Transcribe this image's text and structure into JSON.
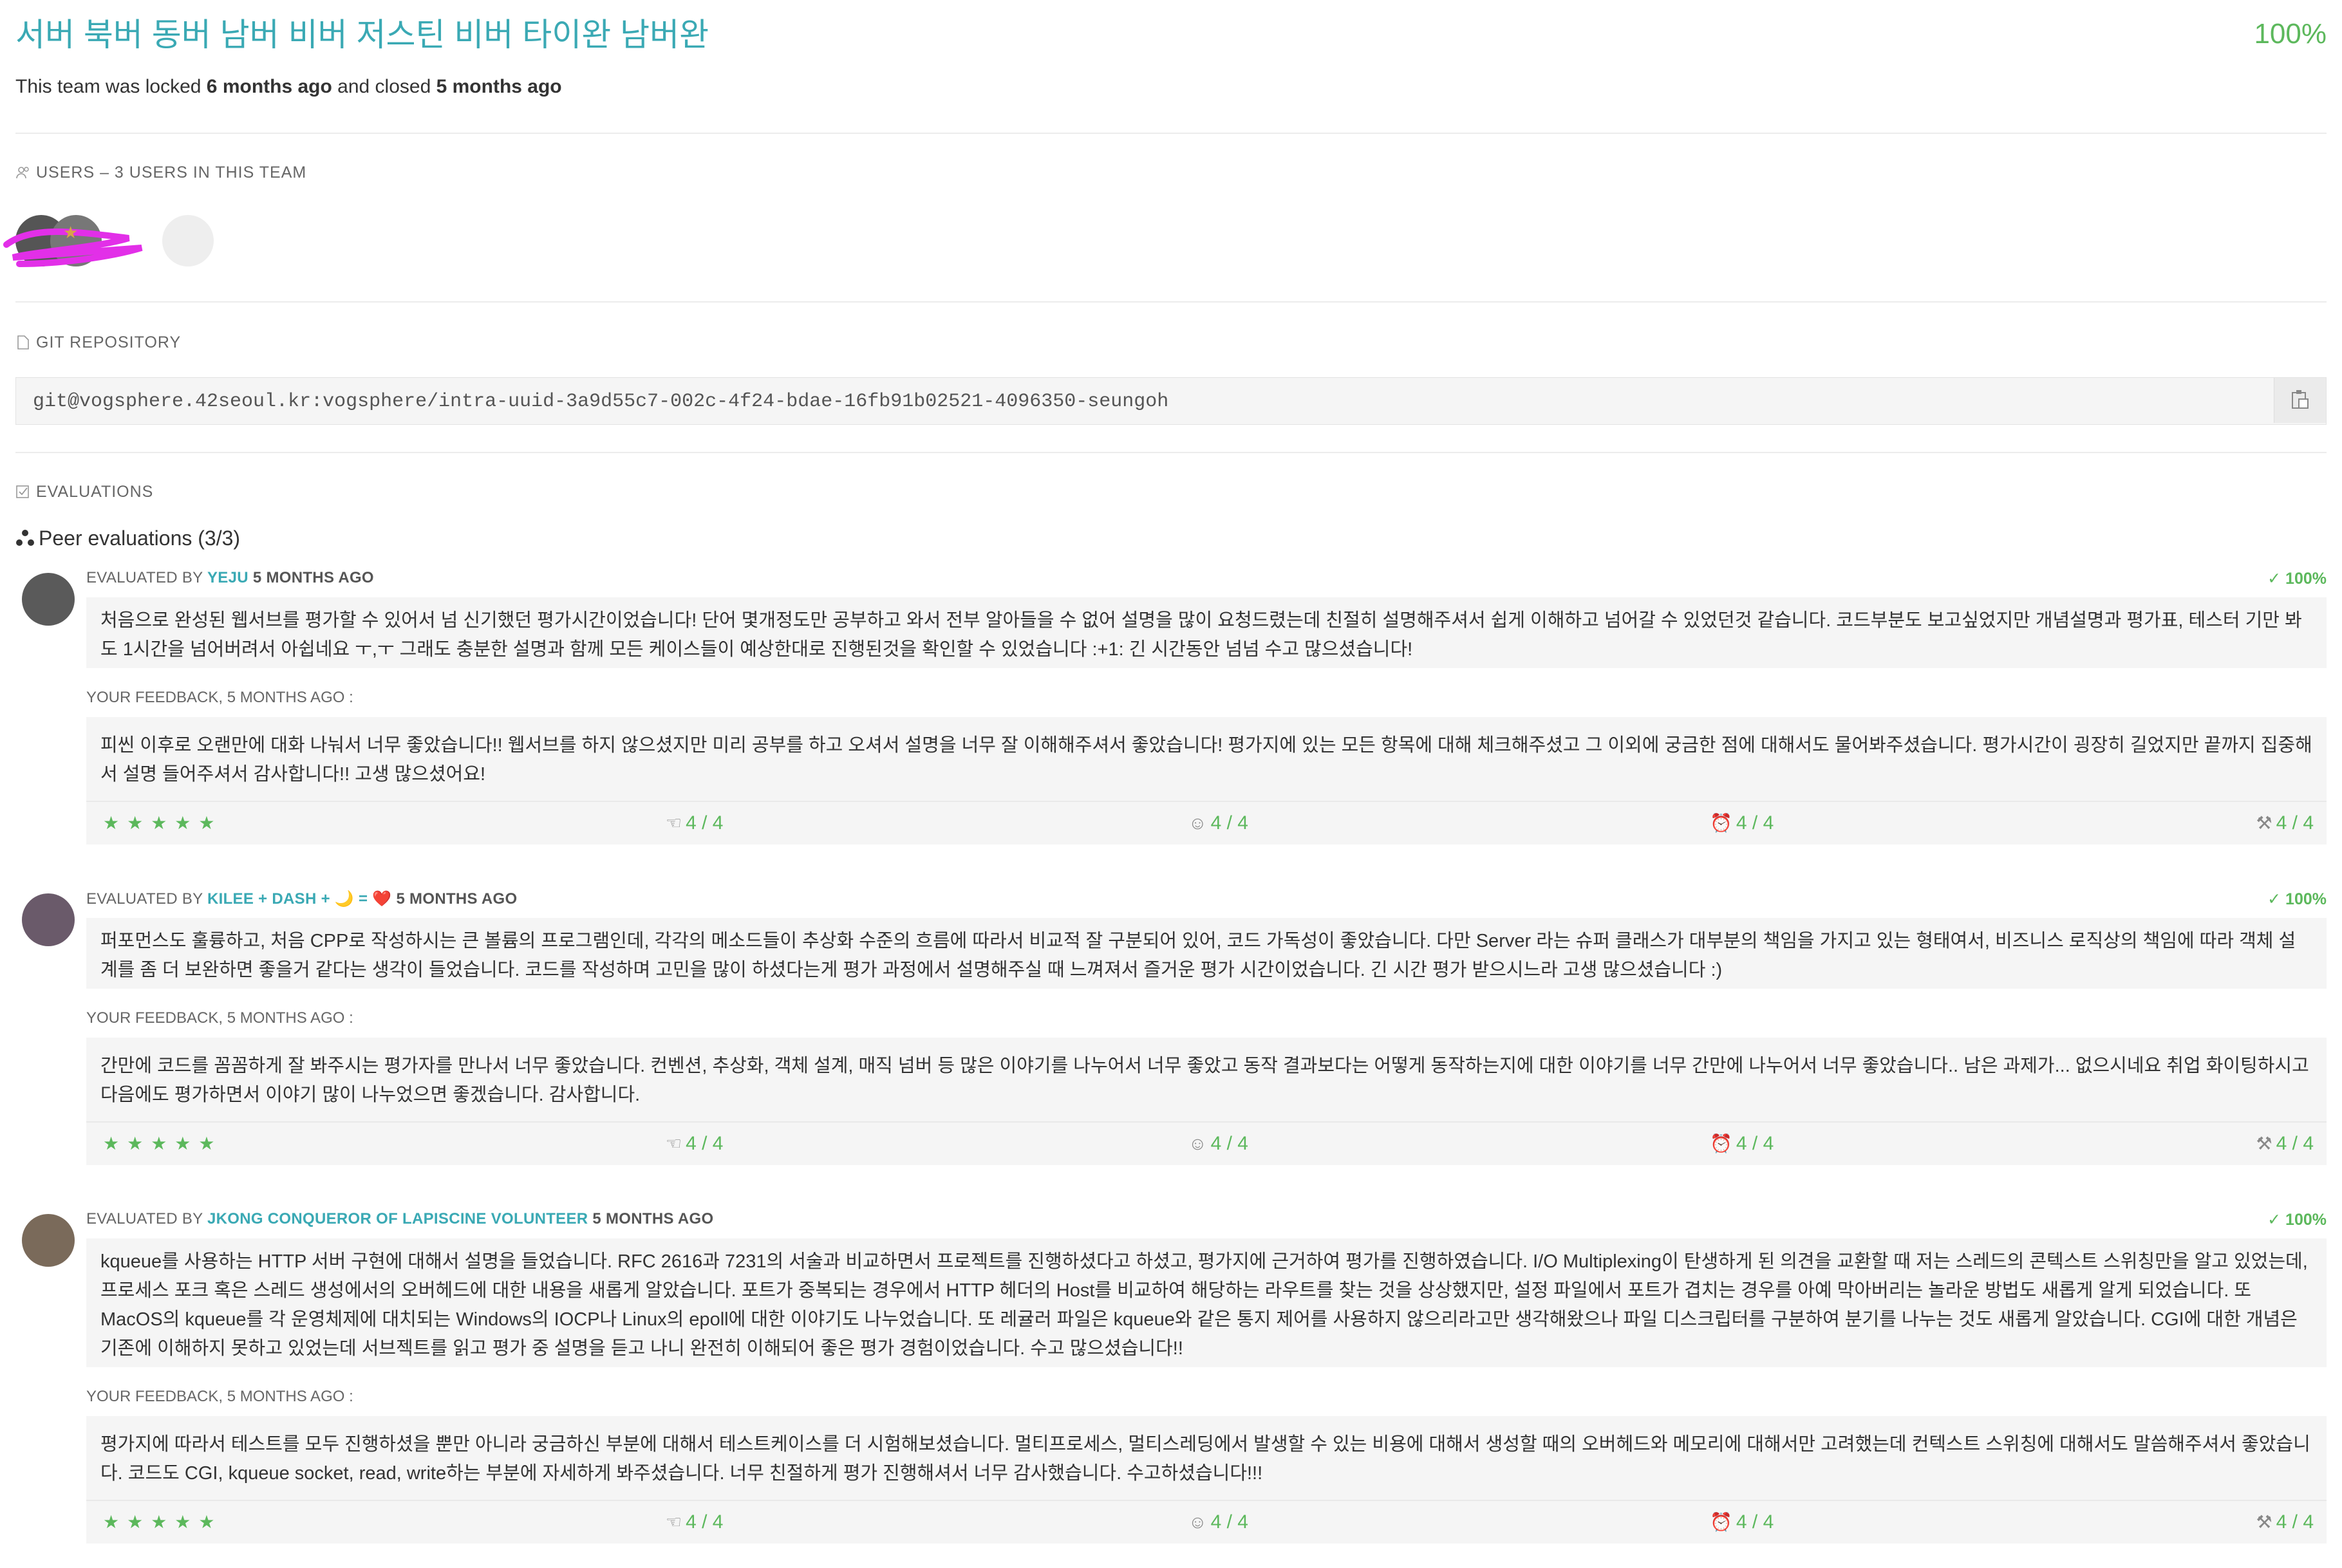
{
  "team": {
    "title": "서버 북버 동버 남버 비버 저스틴 비버 타이완 남버완",
    "percent": "100%",
    "status_prefix": "This team was locked",
    "locked_ago": "6 months ago",
    "status_mid": "and closed",
    "closed_ago": "5 months ago"
  },
  "users": {
    "label": "USERS – 3 USERS IN THIS TEAM",
    "icon": "users-icon"
  },
  "git": {
    "label": "GIT REPOSITORY",
    "url": "git@vogsphere.42seoul.kr:vogsphere/intra-uuid-3a9d55c7-002c-4f24-bdae-16fb91b02521-4096350-seungoh",
    "copy_icon": "clipboard-icon"
  },
  "evaluations": {
    "label": "EVALUATIONS",
    "peer_title": "Peer evaluations (3/3)",
    "items": [
      {
        "prefix": "EVALUATED BY",
        "login": "YEJU",
        "ago": "5 MONTHS AGO",
        "percent": "100%",
        "comment": "처음으로 완성된 웹서브를 평가할 수 있어서 넘 신기했던 평가시간이었습니다! 단어 몇개정도만 공부하고 와서 전부 알아들을 수 없어 설명을 많이 요청드렸는데 친절히 설명해주셔서 쉽게 이해하고 넘어갈 수 있었던것 같습니다. 코드부분도 보고싶었지만 개념설명과 평가표, 테스터 기만 봐도 1시간을 넘어버려서 아쉽네요 ㅜ,ㅜ 그래도 충분한 설명과 함께 모든 케이스들이 예상한대로 진행된것을 확인할 수 있었습니다 :+1: 긴 시간동안 넘넘 수고 많으셨습니다!",
        "feedback_label": "YOUR FEEDBACK, 5 MONTHS AGO :",
        "feedback": "피씬 이후로 오랜만에 대화 나눠서 너무 좋았습니다!! 웹서브를 하지 않으셨지만 미리 공부를 하고 오셔서 설명을 너무 잘 이해해주셔서 좋았습니다! 평가지에 있는 모든 항목에 대해 체크해주셨고 그 이외에 궁금한 점에 대해서도 물어봐주셨습니다. 평가시간이 굉장히 길었지만 끝까지 집중해서 설명 들어주셔서 감사합니다!! 고생 많으셨어요!",
        "stars": "★★★★★",
        "scores": [
          "4 / 4",
          "4 / 4",
          "4 / 4",
          "4 / 4"
        ]
      },
      {
        "prefix": "EVALUATED BY",
        "login": "KILEE + DASH + 🌙 = ❤️",
        "ago": "5 MONTHS AGO",
        "percent": "100%",
        "comment": "퍼포먼스도 훌륭하고, 처음 CPP로 작성하시는 큰 볼륨의 프로그램인데, 각각의 메소드들이 추상화 수준의 흐름에 따라서 비교적 잘 구분되어 있어, 코드 가독성이 좋았습니다. 다만 Server 라는 슈퍼 클래스가 대부분의 책임을 가지고 있는 형태여서, 비즈니스 로직상의 책임에 따라 객체 설계를 좀 더 보완하면 좋을거 같다는 생각이 들었습니다. 코드를 작성하며 고민을 많이 하셨다는게 평가 과정에서 설명해주실 때 느껴져서 즐거운 평가 시간이었습니다. 긴 시간 평가 받으시느라 고생 많으셨습니다 :)",
        "feedback_label": "YOUR FEEDBACK, 5 MONTHS AGO :",
        "feedback": "간만에 코드를 꼼꼼하게 잘 봐주시는 평가자를 만나서 너무 좋았습니다. 컨벤션, 추상화, 객체 설계, 매직 넘버 등 많은 이야기를 나누어서 너무 좋았고 동작 결과보다는 어떻게 동작하는지에 대한 이야기를 너무 간만에 나누어서 너무 좋았습니다.. 남은 과제가... 없으시네요 취업 화이팅하시고 다음에도 평가하면서 이야기 많이 나누었으면 좋겠습니다. 감사합니다.",
        "stars": "★★★★★",
        "scores": [
          "4 / 4",
          "4 / 4",
          "4 / 4",
          "4 / 4"
        ]
      },
      {
        "prefix": "EVALUATED BY",
        "login": "JKONG CONQUEROR OF LAPISCINE VOLUNTEER",
        "ago": "5 MONTHS AGO",
        "percent": "100%",
        "comment": "kqueue를 사용하는 HTTP 서버 구현에 대해서 설명을 들었습니다. RFC 2616과 7231의 서술과 비교하면서 프로젝트를 진행하셨다고 하셨고, 평가지에 근거하여 평가를 진행하였습니다. I/O Multiplexing이 탄생하게 된 의견을 교환할 때 저는 스레드의 콘텍스트 스위칭만을 알고 있었는데, 프로세스 포크 혹은 스레드 생성에서의 오버헤드에 대한 내용을 새롭게 알았습니다. 포트가 중복되는 경우에서 HTTP 헤더의 Host를 비교하여 해당하는 라우트를 찾는 것을 상상했지만, 설정 파일에서 포트가 겹치는 경우를 아예 막아버리는 놀라운 방법도 새롭게 알게 되었습니다. 또 MacOS의 kqueue를 각 운영체제에 대치되는 Windows의 IOCP나 Linux의 epoll에 대한 이야기도 나누었습니다. 또 레귤러 파일은 kqueue와 같은 통지 제어를 사용하지 않으리라고만 생각해왔으나 파일 디스크립터를 구분하여 분기를 나누는 것도 새롭게 알았습니다. CGI에 대한 개념은 기존에 이해하지 못하고 있었는데 서브젝트를 읽고 평가 중 설명을 듣고 나니 완전히 이해되어 좋은 평가 경험이었습니다. 수고 많으셨습니다!!",
        "feedback_label": "YOUR FEEDBACK, 5 MONTHS AGO :",
        "feedback": "평가지에 따라서 테스트를 모두 진행하셨을 뿐만 아니라 궁금하신 부분에 대해서 테스트케이스를 더 시험해보셨습니다. 멀티프로세스, 멀티스레딩에서 발생할 수 있는 비용에 대해서 생성할 때의 오버헤드와 메모리에 대해서만 고려했는데 컨텍스트 스위칭에 대해서도 말씀해주셔서 좋았습니다. 코드도 CGI, kqueue socket, read, write하는 부분에 자세하게 봐주셨습니다. 너무 친절하게 평가 진행해셔서 너무 감사했습니다. 수고하셨습니다!!!",
        "stars": "★★★★★",
        "scores": [
          "4 / 4",
          "4 / 4",
          "4 / 4",
          "4 / 4"
        ]
      }
    ]
  },
  "score_icons": [
    "kindness-icon",
    "smile-icon",
    "alarm-icon",
    "hammer-icon"
  ],
  "colors": {
    "accent": "#3aa9b4",
    "success": "#5cb85c"
  }
}
